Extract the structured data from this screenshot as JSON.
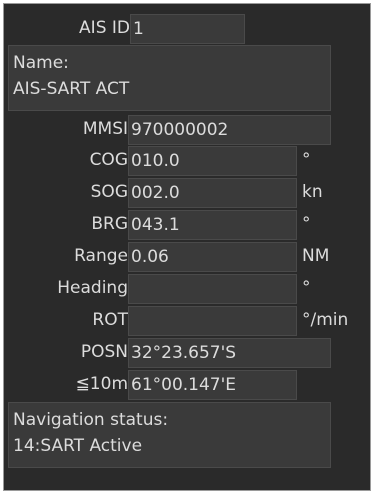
{
  "ais_id": {
    "label": "AIS ID",
    "value": "1"
  },
  "name": {
    "label": "Name:",
    "value": "AIS-SART ACT"
  },
  "rows": [
    {
      "label": "MMSI",
      "value": "970000002",
      "unit": ""
    },
    {
      "label": "COG",
      "value": "010.0",
      "unit": "°"
    },
    {
      "label": "SOG",
      "value": "002.0",
      "unit": "kn"
    },
    {
      "label": "BRG",
      "value": "043.1",
      "unit": "°"
    },
    {
      "label": "Range",
      "value": "0.06",
      "unit": "NM"
    },
    {
      "label": "Heading",
      "value": "",
      "unit": "°"
    },
    {
      "label": "ROT",
      "value": "",
      "unit": "°/min"
    },
    {
      "label": "POSN",
      "value": "32°23.657'S",
      "unit": ""
    },
    {
      "label": "≦10m",
      "value": "61°00.147'E",
      "unit": ""
    }
  ],
  "nav_status": {
    "label": "Navigation status:",
    "value": "14:SART Active"
  }
}
